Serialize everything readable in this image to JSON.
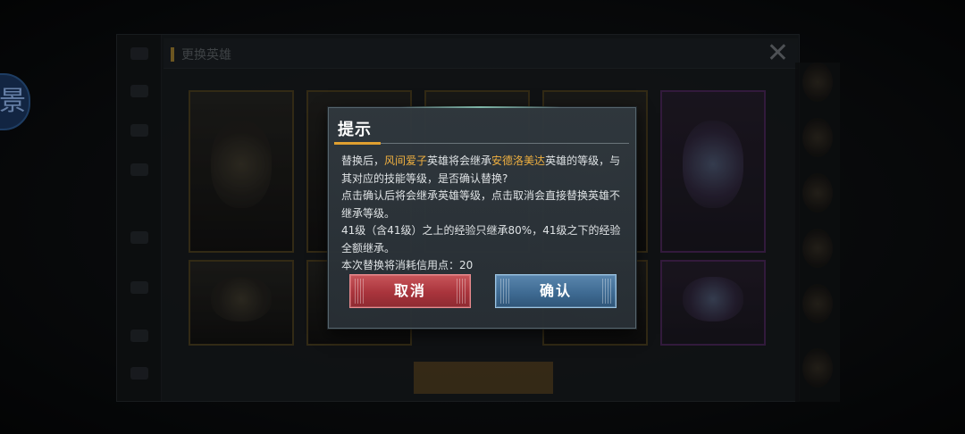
{
  "side_bubble": {
    "glyph": "景"
  },
  "background": {
    "header_title": "更换英雄",
    "close_glyph": "✕"
  },
  "dialog": {
    "title": "提示",
    "body": {
      "p1_prefix": "替换后，",
      "p1_hero_a": "风间爱子",
      "p1_mid": "英雄将会继承",
      "p1_hero_b": "安德洛美达",
      "p1_suffix": "英雄的等级，与其对应的技能等级，是否确认替换?",
      "p2": "点击确认后将会继承英雄等级，点击取消会直接替换英雄不继承等级。",
      "p3": "41级（含41级）之上的经验只继承80%，41级之下的经验全额继承。",
      "p4": "本次替换将消耗信用点：20"
    },
    "cancel_label": "取消",
    "confirm_label": "确认"
  },
  "colors": {
    "highlight": "#f0b040",
    "cancel": "#a9343c",
    "confirm": "#3f6b93",
    "title_accent": "#e0a030"
  }
}
